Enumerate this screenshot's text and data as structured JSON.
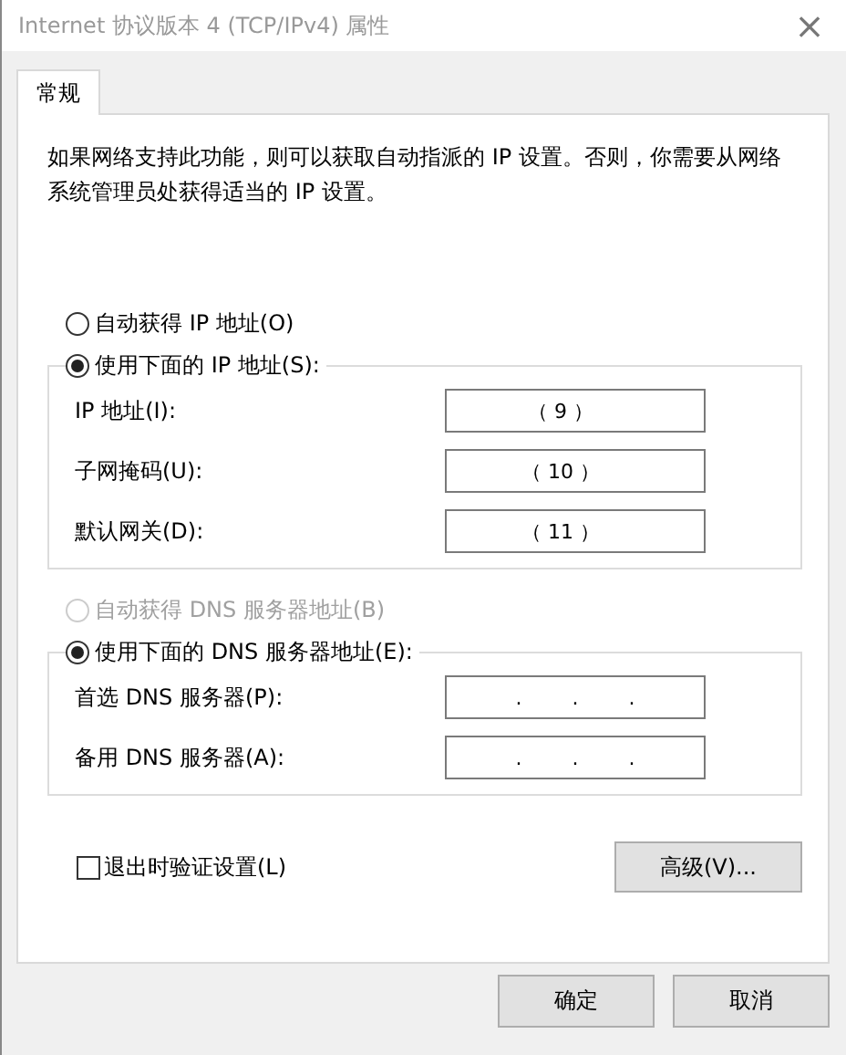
{
  "window": {
    "title": "Internet 协议版本 4 (TCP/IPv4) 属性",
    "close": "×"
  },
  "tabs": [
    {
      "label": "常规",
      "selected": true
    }
  ],
  "description": "如果网络支持此功能，则可以获取自动指派的 IP 设置。否则，你需要从网络系统管理员处获得适当的 IP 设置。",
  "ip_options": [
    {
      "label": "自动获得 IP 地址(O)",
      "selected": false,
      "disabled": false
    },
    {
      "label": "使用下面的 IP 地址(S):",
      "selected": true,
      "disabled": false
    }
  ],
  "ip_fields": [
    {
      "label": "IP 地址(I):",
      "value": "（ 9 ）"
    },
    {
      "label": "子网掩码(U):",
      "value": "（ 10 ）"
    },
    {
      "label": "默认网关(D):",
      "value": "（ 11 ）"
    }
  ],
  "dns_options": [
    {
      "label": "自动获得 DNS 服务器地址(B)",
      "selected": false,
      "disabled": true
    },
    {
      "label": "使用下面的 DNS 服务器地址(E):",
      "selected": true,
      "disabled": false
    }
  ],
  "dns_fields": [
    {
      "label": "首选 DNS 服务器(P):",
      "separators": [
        ".",
        ".",
        "."
      ]
    },
    {
      "label": "备用 DNS 服务器(A):",
      "separators": [
        ".",
        ".",
        "."
      ]
    }
  ],
  "validate": {
    "label": "退出时验证设置(L)",
    "checked": false
  },
  "advanced_button": "高级(V)...",
  "buttons": [
    "确定",
    "取消"
  ]
}
